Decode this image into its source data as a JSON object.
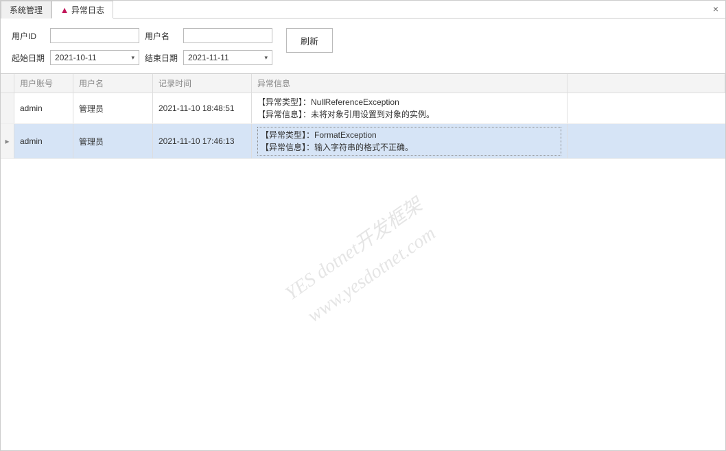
{
  "tabs": [
    {
      "label": "系统管理",
      "active": false
    },
    {
      "label": "异常日志",
      "active": true
    }
  ],
  "close_label": "×",
  "filters": {
    "user_id_label": "用户ID",
    "user_id_value": "",
    "user_name_label": "用户名",
    "user_name_value": "",
    "start_date_label": "起始日期",
    "start_date_value": "2021-10-11",
    "end_date_label": "结束日期",
    "end_date_value": "2021-11-11",
    "refresh_label": "刷新"
  },
  "grid": {
    "columns": {
      "account": "用户账号",
      "username": "用户名",
      "time": "记录时间",
      "info": "异常信息"
    },
    "rows": [
      {
        "indicator": "",
        "account": "admin",
        "username": "管理员",
        "time": "2021-11-10 18:48:51",
        "info": "【异常类型】：NullReferenceException\n【异常信息】：未将对象引用设置到对象的实例。",
        "selected": false
      },
      {
        "indicator": "▸",
        "account": "admin",
        "username": "管理员",
        "time": "2021-11-10 17:46:13",
        "info": "【异常类型】：FormatException\n【异常信息】：输入字符串的格式不正确。",
        "selected": true
      }
    ]
  },
  "watermark": "YES dotnet开发框架\nwww.yesdotnet.com"
}
